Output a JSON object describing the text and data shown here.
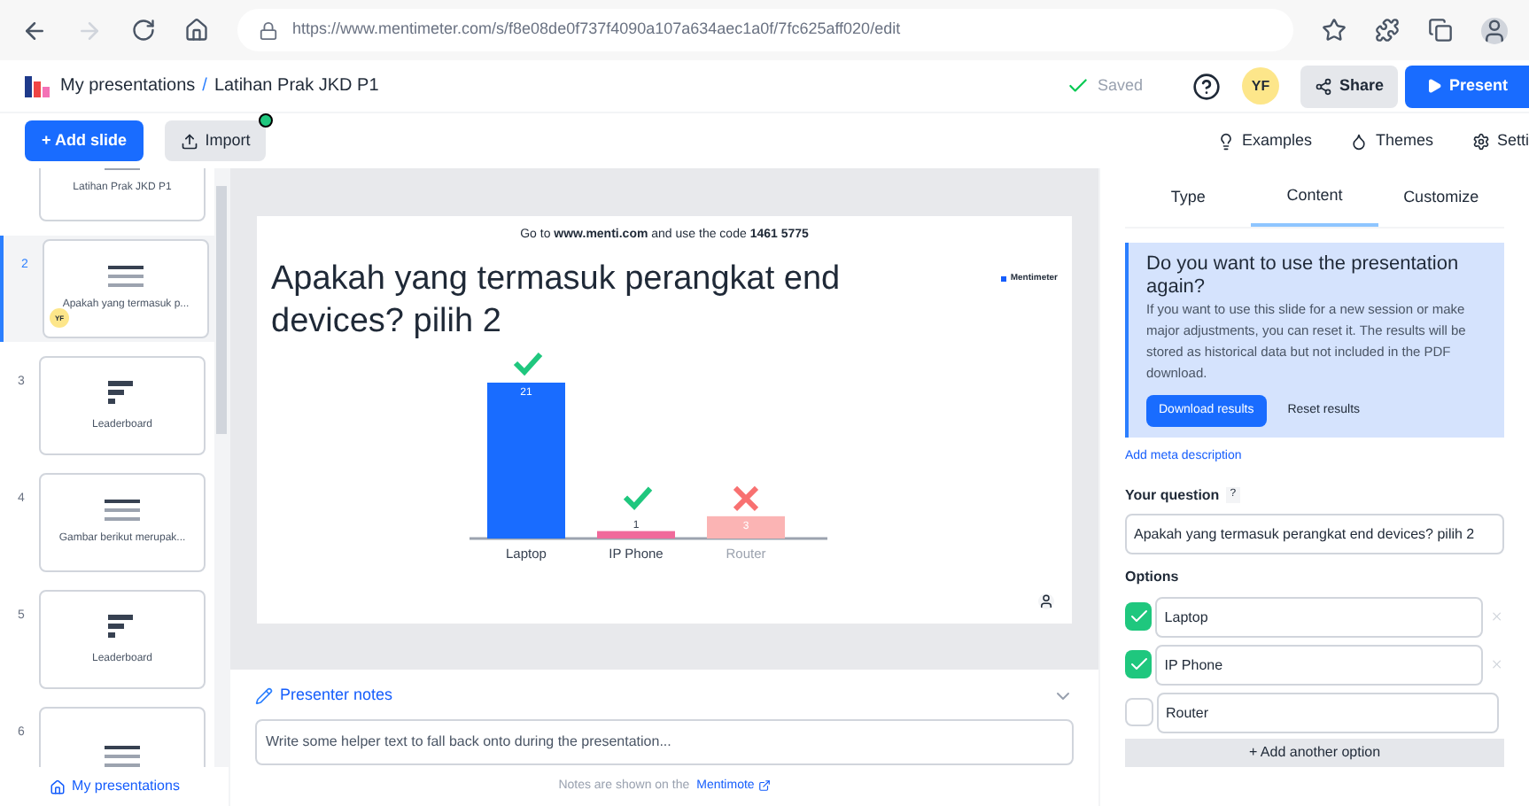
{
  "browser": {
    "url": "https://www.mentimeter.com/s/f8e08de0f737f4090a107a634aec1a0f/7fc625aff020/edit"
  },
  "header": {
    "breadcrumb_root": "My presentations",
    "separator": "/",
    "title": "Latihan Prak JKD P1",
    "status": "Saved",
    "avatar": "YF",
    "share": "Share",
    "present": "Present"
  },
  "toolbar": {
    "add_slide": "+ Add slide",
    "import": "Import",
    "import_badge": true,
    "links": [
      "Examples",
      "Themes",
      "Setti"
    ]
  },
  "slides": [
    {
      "kind": "question",
      "title": "Latihan Prak JKD P1",
      "selected": false
    },
    {
      "number": "2",
      "kind": "question",
      "title": "Apakah yang termasuk p...",
      "selected": true,
      "avatar": "YF"
    },
    {
      "number": "3",
      "kind": "leaderboard",
      "title": "Leaderboard",
      "selected": false
    },
    {
      "number": "4",
      "kind": "question",
      "title": "Gambar berikut merupak...",
      "selected": false
    },
    {
      "number": "5",
      "kind": "leaderboard",
      "title": "Leaderboard",
      "selected": false
    },
    {
      "number": "6",
      "kind": "question",
      "selected": false
    }
  ],
  "sidebar_footer": "My presentations",
  "slide": {
    "instruction": "Go to **www.menti.com** and use the code **1461 5775**",
    "brand": "Mentimeter",
    "question": "Apakah yang termasuk perangkat end devices? pilih 2",
    "chart_data": {
      "type": "bar",
      "categories": [
        "Laptop",
        "IP Phone",
        "Router"
      ],
      "values": [
        21,
        1,
        3
      ],
      "data_labels": true
    }
  },
  "notes": {
    "title": "Presenter notes",
    "placeholder": "Write some helper text to fall back onto during the presentation...",
    "footer": "Notes are shown on the",
    "link": "Mentimote"
  },
  "panel": {
    "tabs": [
      {
        "label": "Type",
        "selected": false
      },
      {
        "label": "Content",
        "selected": true
      },
      {
        "label": "Customize",
        "selected": false
      }
    ],
    "notice": {
      "title": "Do you want to use the presentation again?",
      "body": "If you want to use this slide for a new session or make major adjustments, you can reset it. The results will be stored as historical data but not included in the PDF download.",
      "primary": "Download results",
      "secondary": "Reset results"
    },
    "meta_link": "Add meta description",
    "question_label": "Your question",
    "help": "?",
    "question_value": "Apakah yang termasuk perangkat end devices? pilih 2",
    "options_label": "Options",
    "options": [
      {
        "value": "Laptop",
        "checked": true
      },
      {
        "value": "IP Phone",
        "checked": true
      },
      {
        "value": "Router",
        "checked": false
      }
    ],
    "add_option": "+ Add another option"
  }
}
